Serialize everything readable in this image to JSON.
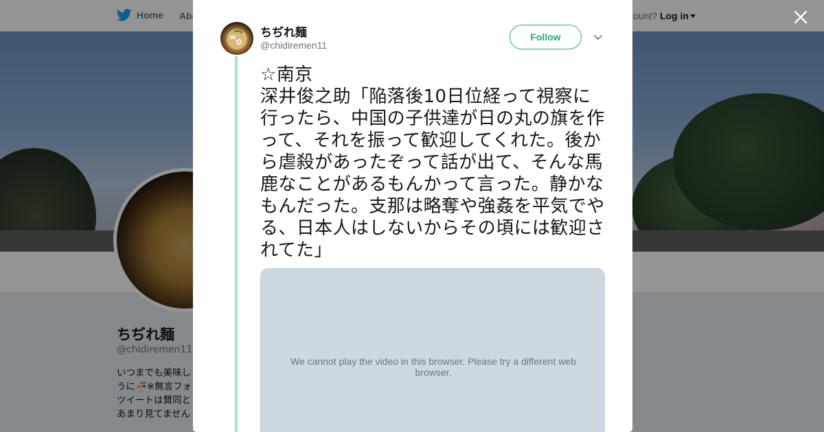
{
  "nav": {
    "home_label": "Home",
    "about_label": "Abo",
    "account_prompt": "ccount?",
    "login_label": "Log in"
  },
  "profile": {
    "name": "ちぢれ麺",
    "handle": "@chidiremen11",
    "bio": "いつまでも美味し\nうに🍜※無言フォ\nツイートは賛同と\nあまり見てません"
  },
  "tweet": {
    "author_name": "ちぢれ麺",
    "author_handle": "@chidiremen11",
    "follow_label": "Follow",
    "text": "☆南京\n深井俊之助「陥落後10日位経って視察に行ったら、中国の子供達が日の丸の旗を作って、それを振って歓迎してくれた。後から虐殺があったぞって話が出て、そんな馬鹿なことがあるもんかって言った。静かなもんだった。支那は略奪や強姦を平気でやる、日本人はしないからその頃には歓迎されてた」",
    "video_message": "We cannot play the video in this browser. Please try a different web browser."
  },
  "colors": {
    "accent": "#1fa57e",
    "thread_line": "#a3e8c6",
    "twitter_blue": "#1da1f2"
  },
  "icons": [
    "twitter-bird-icon",
    "caret-down-icon",
    "close-icon",
    "chevron-down-icon"
  ]
}
